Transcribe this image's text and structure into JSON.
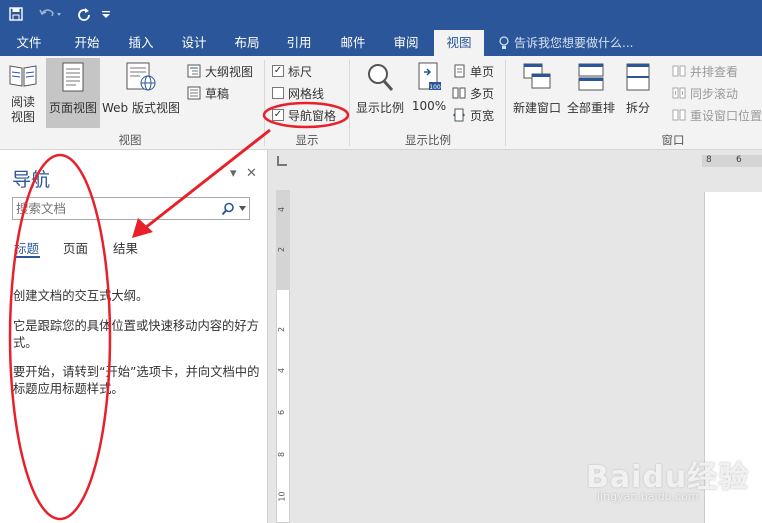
{
  "ribbon_tabs": [
    "文件",
    "开始",
    "插入",
    "设计",
    "布局",
    "引用",
    "邮件",
    "审阅",
    "视图"
  ],
  "tell_me": "告诉我您想要做什么...",
  "views_group": {
    "label": "视图",
    "read_mode": "阅读\n视图",
    "print_layout": "页面视图",
    "web_layout": "Web 版式视图",
    "outline": "大纲视图",
    "draft": "草稿"
  },
  "show_group": {
    "label": "显示",
    "ruler": "标尺",
    "gridlines": "网格线",
    "nav_pane": "导航窗格"
  },
  "zoom_group": {
    "label": "显示比例",
    "zoom": "显示比例",
    "hundred": "100%",
    "one_page": "单页",
    "multi_page": "多页",
    "page_width": "页宽"
  },
  "window_group": {
    "label": "窗口",
    "new_window": "新建窗口",
    "arrange_all": "全部重排",
    "split": "拆分",
    "side_by_side": "并排查看",
    "sync_scroll": "同步滚动",
    "reset_position": "重设窗口位置"
  },
  "nav_pane": {
    "title": "导航",
    "search_placeholder": "搜索文档",
    "tabs": [
      "标题",
      "页面",
      "结果"
    ],
    "text1": "创建文档的交互式大纲。",
    "text2": "它是跟踪您的具体位置或快速移动内容的好方式。",
    "text3": "要开始，请转到“开始”选项卡，并向文档中的标题应用标题样式。"
  },
  "ruler": {
    "h_labels": [
      "8",
      "6"
    ],
    "v_labels": [
      "4",
      "2",
      "2",
      "4",
      "6",
      "8",
      "10"
    ]
  },
  "watermark": {
    "brand": "Baidu经验",
    "url": "jingyan.baidu.com"
  },
  "colors": {
    "accent": "#2b579a",
    "annotation": "#e8202a"
  }
}
